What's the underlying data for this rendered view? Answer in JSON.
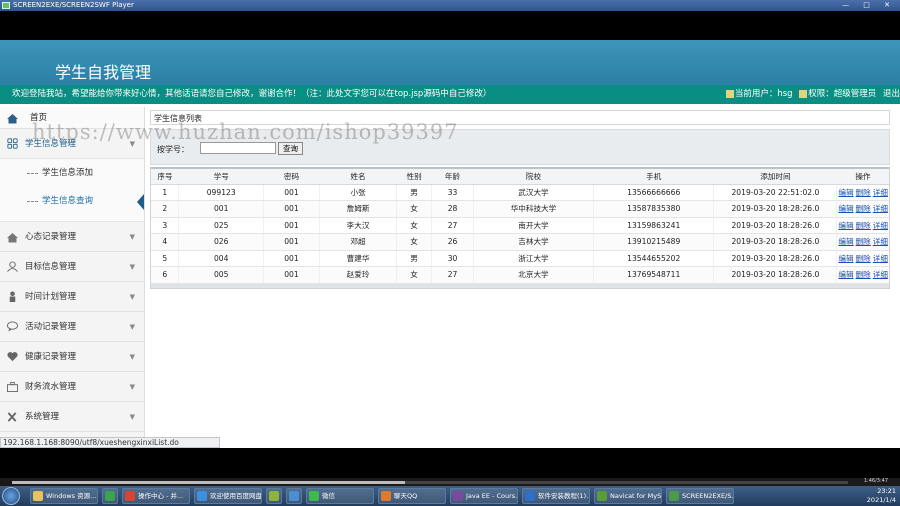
{
  "window": {
    "title": "SCREEN2EXE/SCREEN2SWF Player",
    "controls": "— □ ✕"
  },
  "app": {
    "title": "学生自我管理"
  },
  "notice": {
    "text": "欢迎登陆我站，希望能给你带来好心情，其他话语请您自己修改，谢谢合作！（注：此处文字您可以在top.jsp源码中自己修改）",
    "current_user": "当前用户：hsg",
    "role": "权限：超级管理员",
    "logout": "退出"
  },
  "sidebar": {
    "home": "首页",
    "groups": [
      {
        "label": "学生信息管理",
        "icon": "grid-icon",
        "open": true
      },
      {
        "label": "心态记录管理",
        "icon": "home-icon"
      },
      {
        "label": "目标信息管理",
        "icon": "user-icon"
      },
      {
        "label": "时间计划管理",
        "icon": "person-icon"
      },
      {
        "label": "活动记录管理",
        "icon": "chat-icon"
      },
      {
        "label": "健康记录管理",
        "icon": "heart-icon"
      },
      {
        "label": "财务流水管理",
        "icon": "briefcase-icon"
      },
      {
        "label": "系统管理",
        "icon": "tools-icon"
      }
    ],
    "sub_items": [
      {
        "label": "学生信息添加",
        "active": false
      },
      {
        "label": "学生信息查询",
        "active": true
      }
    ]
  },
  "main": {
    "panel_title": "学生信息列表",
    "search": {
      "label": "按学号：",
      "value": "",
      "button": "查询"
    },
    "columns": [
      "序号",
      "学号",
      "密码",
      "姓名",
      "性别",
      "年龄",
      "院校",
      "手机",
      "添加时间",
      "操作"
    ],
    "rows": [
      [
        "1",
        "099123",
        "001",
        "小张",
        "男",
        "33",
        "武汉大学",
        "13566666666",
        "2019-03-20 22:51:02.0"
      ],
      [
        "2",
        "001",
        "001",
        "詹姆斯",
        "女",
        "28",
        "华中科技大学",
        "13587835380",
        "2019-03-20 18:28:26.0"
      ],
      [
        "3",
        "025",
        "001",
        "李大汉",
        "女",
        "27",
        "南开大学",
        "13159863241",
        "2019-03-20 18:28:26.0"
      ],
      [
        "4",
        "026",
        "001",
        "邓超",
        "女",
        "26",
        "吉林大学",
        "13910215489",
        "2019-03-20 18:28:26.0"
      ],
      [
        "5",
        "004",
        "001",
        "曹建华",
        "男",
        "30",
        "浙江大学",
        "13544655202",
        "2019-03-20 18:28:26.0"
      ],
      [
        "6",
        "005",
        "001",
        "赵爱玲",
        "女",
        "27",
        "北京大学",
        "13769548711",
        "2019-03-20 18:28:26.0"
      ]
    ],
    "ops": [
      "编辑",
      "删除",
      "详细"
    ]
  },
  "status_url": "192.168.1.168:8090/utf8/xueshengxinxiList.do",
  "watermark": "https://www.huzhan.com/ishop39397",
  "player": {
    "time": "1:46/3:47",
    "progress": 0.47
  },
  "taskbar": {
    "tasks": [
      {
        "label": "Windows 资源...",
        "color": "#e8c35a"
      },
      {
        "label": "",
        "color": "#3aa54a"
      },
      {
        "label": "操作中心 - 并...",
        "color": "#d9442e"
      },
      {
        "label": "欢迎使用百度网盘",
        "color": "#3d8fe0"
      },
      {
        "label": "",
        "color": "#8fb43a"
      },
      {
        "label": "",
        "color": "#4a8fd6"
      },
      {
        "label": "微信",
        "color": "#3dbb4a"
      },
      {
        "label": "聊天QQ",
        "color": "#e07b2a"
      },
      {
        "label": "Java EE - Cours...",
        "color": "#7a4a9e"
      },
      {
        "label": "软件安装教程(1)...",
        "color": "#2f6fc9"
      },
      {
        "label": "Navicat for MyS...",
        "color": "#5a9b3a"
      },
      {
        "label": "SCREEN2EXE/S...",
        "color": "#4a9a4a"
      }
    ],
    "clock_time": "23:21",
    "clock_date": "2021/1/4"
  }
}
